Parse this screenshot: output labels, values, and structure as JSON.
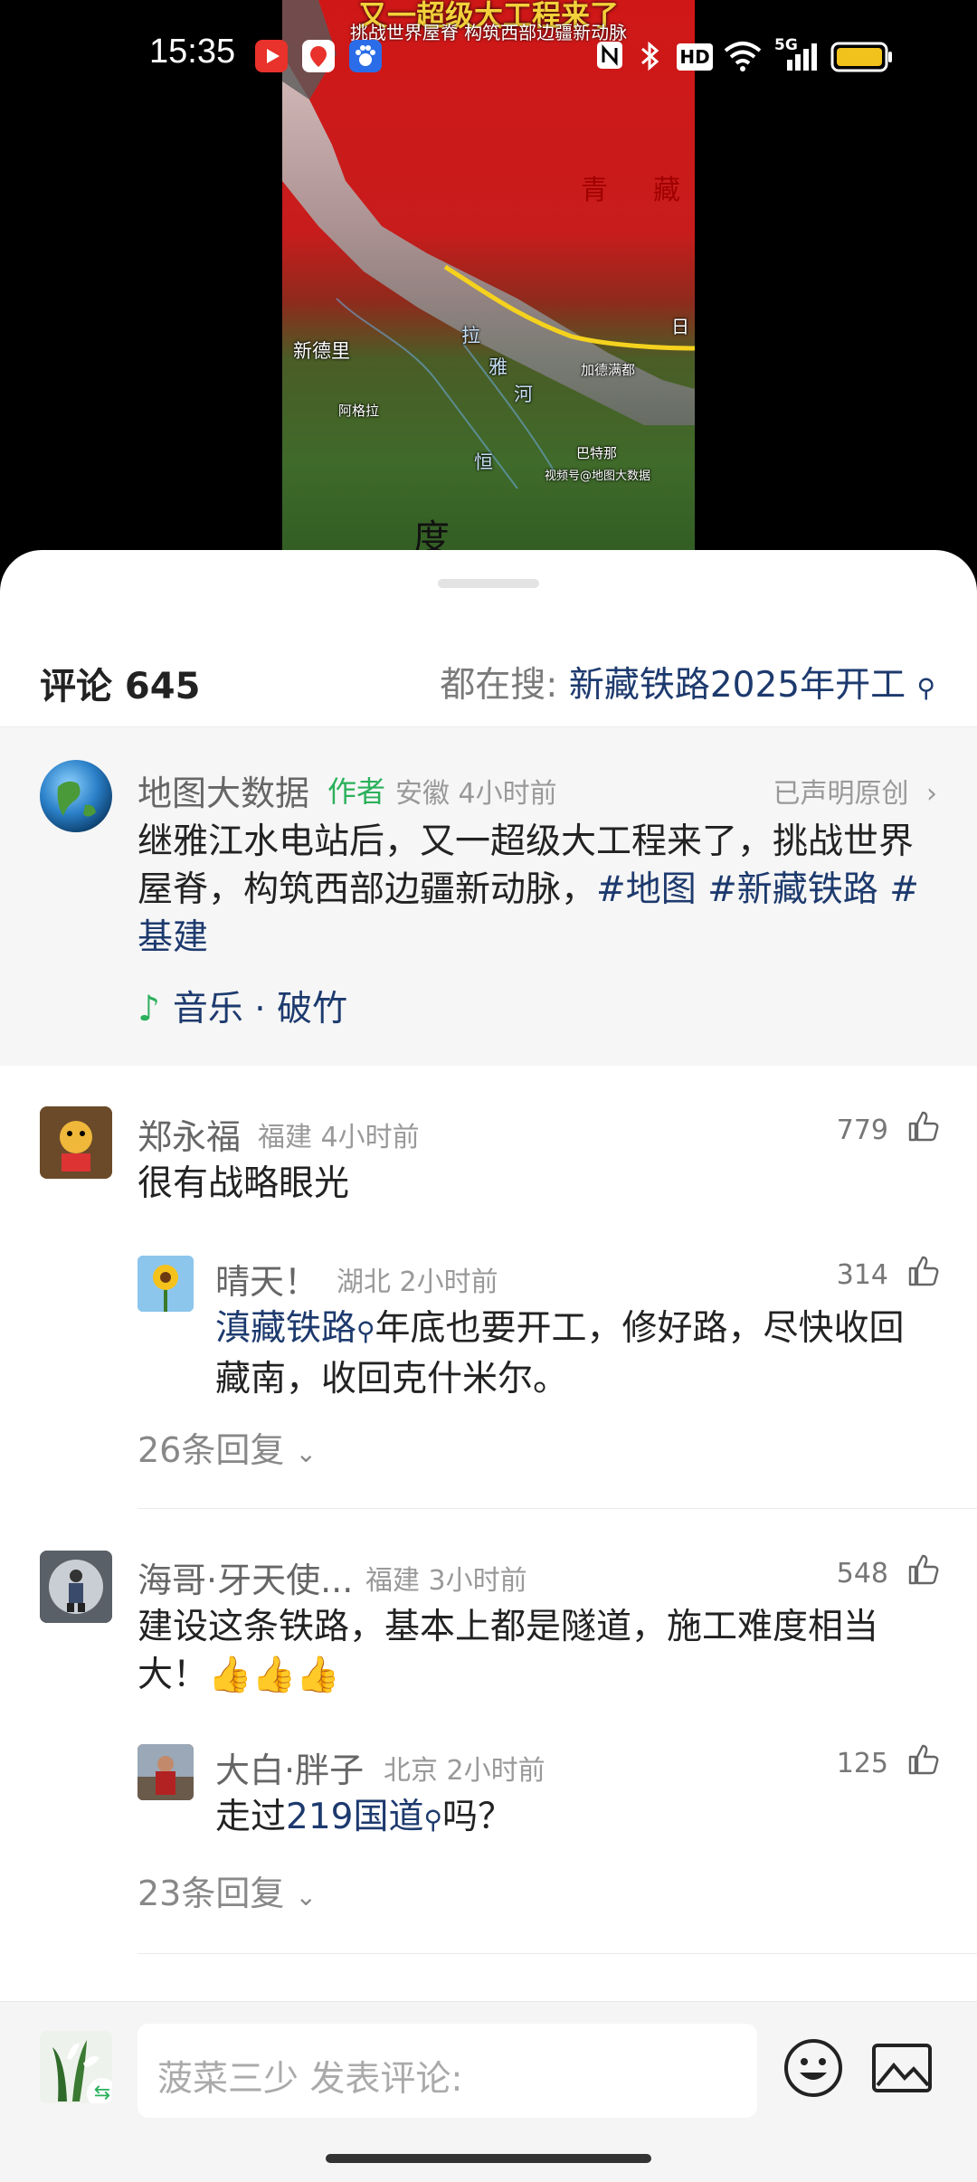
{
  "status_bar": {
    "time": "15:35",
    "network": "5G",
    "hd": "HD",
    "icons": [
      "video-app-icon",
      "maps-app-icon",
      "baidu-app-icon",
      "nfc-icon",
      "bluetooth-icon",
      "hd-icon",
      "wifi-icon",
      "signal-icon",
      "battery-icon"
    ]
  },
  "video": {
    "title": "又一超级大工程来了",
    "subtitle": "挑战世界屋脊 构筑西部边疆新动脉",
    "labels": {
      "new_delhi": "新德里",
      "agra": "阿格拉",
      "qing": "青",
      "zang": "藏",
      "la": "拉",
      "ya": "雅",
      "he": "河",
      "ri": "日",
      "jiademan": "加德满都",
      "hengtehe": "恒",
      "biratnagar": "巴特那",
      "du": "度",
      "watermark": "视频号@地图大数据"
    }
  },
  "sheet": {
    "comments_title": "评论 645",
    "hot_search_prefix": "都在搜:",
    "hot_search_keyword": "新藏铁路2025年开工"
  },
  "author_post": {
    "name": "地图大数据",
    "tag": "作者",
    "location_time": "安徽  4小时前",
    "originality": "已声明原创",
    "text_plain": "继雅江水电站后，又一超级大工程来了，挑战世界屋脊，构筑西部边疆新动脉，",
    "hashtags": [
      "#地图",
      "#新藏铁路",
      "#基建"
    ],
    "music_label": "音乐 · 破竹"
  },
  "comments": [
    {
      "name": "郑永福",
      "meta": "福建  4小时前",
      "text": "很有战略眼光",
      "likes": "779",
      "reply": {
        "name": "晴天！",
        "meta": "湖北  2小时前",
        "link": "滇藏铁路",
        "text_line1_after_link": "年底也要开工，修好路，尽快收回",
        "text_line2": "藏南，收回克什米尔。",
        "likes": "314"
      },
      "more_replies": "26条回复"
    },
    {
      "name": "海哥·牙天使...",
      "meta": "福建  3小时前",
      "text": "建设这条铁路，基本上都是隧道，施工难度相当大！👍👍👍",
      "likes": "548",
      "reply": {
        "name": "大白·胖子",
        "meta": "北京  2小时前",
        "text_before_link": "走过",
        "link": "219国道",
        "text_after_link": "吗？",
        "likes": "125"
      },
      "more_replies": "23条回复"
    }
  ],
  "input_bar": {
    "placeholder": "菠菜三少 发表评论:"
  }
}
